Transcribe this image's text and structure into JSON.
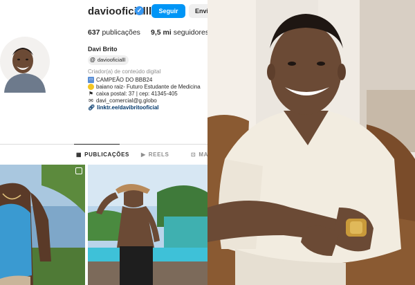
{
  "profile": {
    "username": "daviooficialll",
    "follow_label": "Seguir",
    "message_label": "Envia",
    "posts_count": "637",
    "posts_label": "publicações",
    "followers_count": "9,5 mi",
    "followers_label": "seguidores",
    "full_name": "Davi Brito",
    "threads_handle": "daviooficialll",
    "category": "Criador(a) de conteúdo digital",
    "bio": [
      {
        "icon": "tv-icon",
        "text": "CAMPEÃO DO BBB24"
      },
      {
        "icon": "sun-icon",
        "text": "baiano raiz- Futuro Estudante de Medicina"
      },
      {
        "icon": "mailbox-icon",
        "text": "caixa postal: 37 | cep: 41345-405"
      },
      {
        "icon": "envelope-icon",
        "text": "davi_comercial@g.globo"
      }
    ],
    "link": "linktr.ee/davibritooficial"
  },
  "tabs": [
    {
      "label": "PUBLICAÇÕES",
      "active": true
    },
    {
      "label": "REELS",
      "active": false
    },
    {
      "label": "MAR",
      "active": false
    }
  ],
  "colors": {
    "accent": "#0095f6",
    "verified": "#3897f0",
    "link": "#00376b",
    "muted": "#8e8e8e"
  }
}
